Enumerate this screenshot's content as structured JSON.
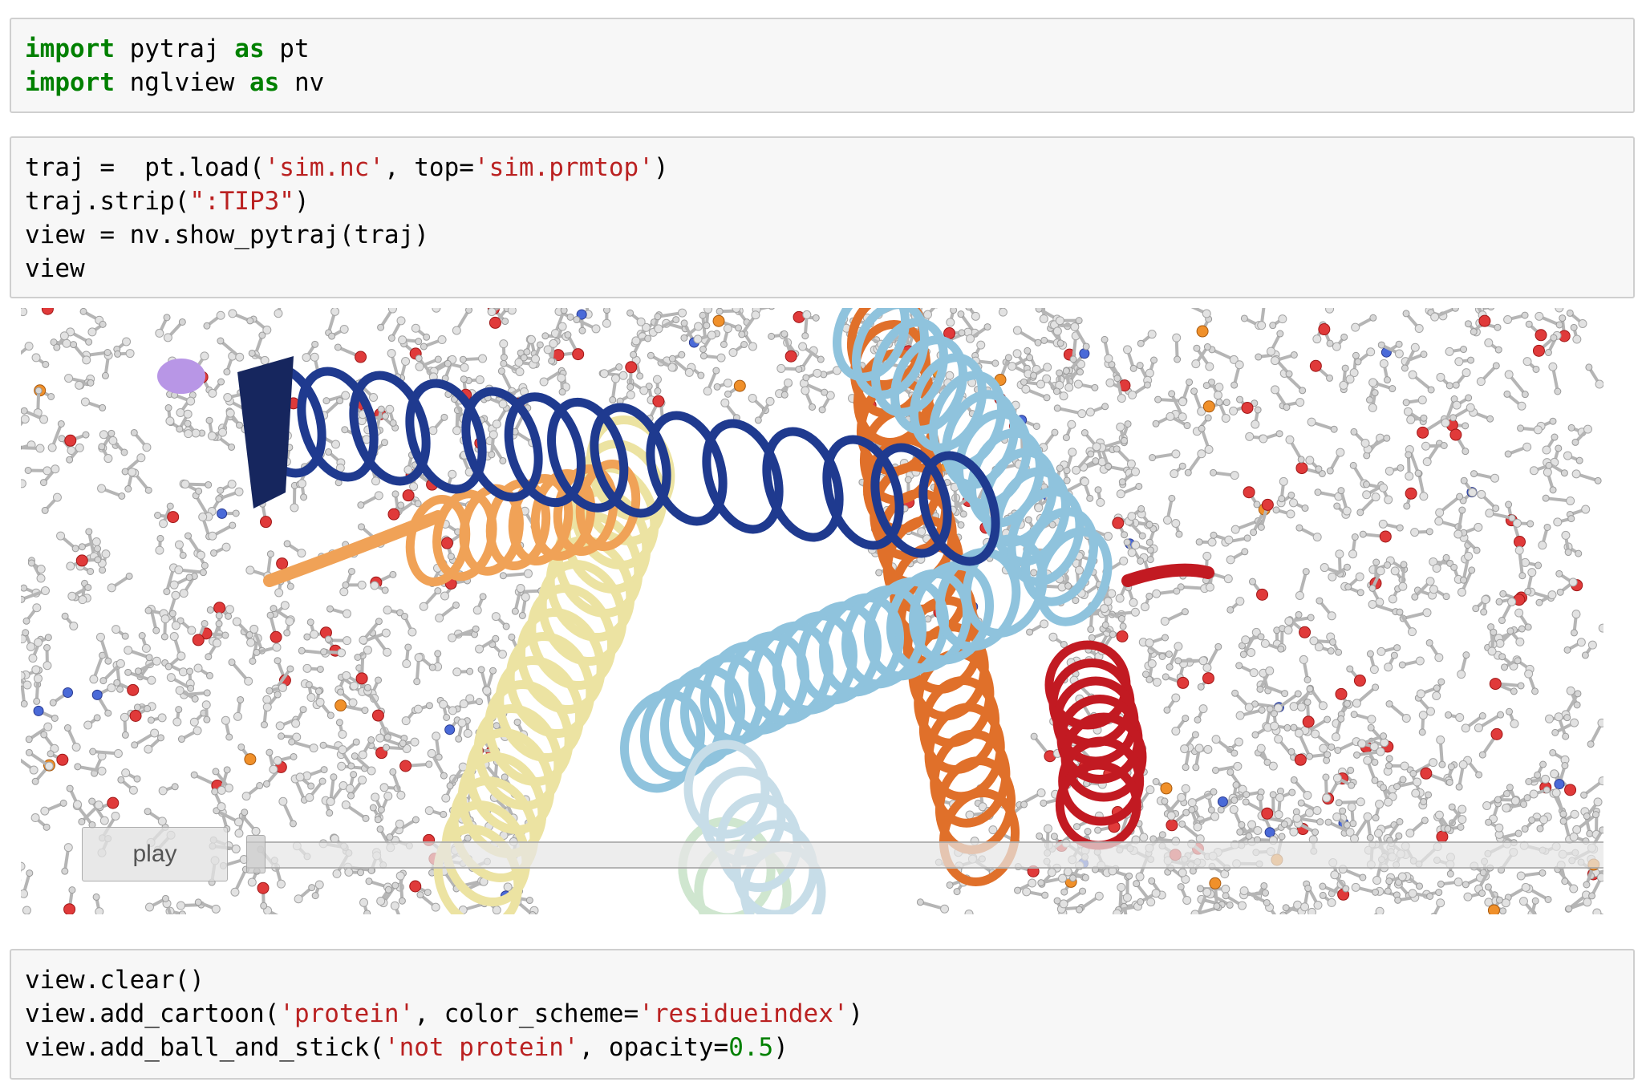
{
  "cells": [
    {
      "lines": [
        [
          {
            "t": "import",
            "c": "kw"
          },
          {
            "t": " pytraj ",
            "c": ""
          },
          {
            "t": "as",
            "c": "kw"
          },
          {
            "t": " pt",
            "c": ""
          }
        ],
        [
          {
            "t": "import",
            "c": "kw"
          },
          {
            "t": " nglview ",
            "c": ""
          },
          {
            "t": "as",
            "c": "kw"
          },
          {
            "t": " nv",
            "c": ""
          }
        ]
      ]
    },
    {
      "lines": [
        [
          {
            "t": "traj =  pt.load(",
            "c": ""
          },
          {
            "t": "'sim.nc'",
            "c": "str"
          },
          {
            "t": ", top=",
            "c": ""
          },
          {
            "t": "'sim.prmtop'",
            "c": "str"
          },
          {
            "t": ")",
            "c": ""
          }
        ],
        [
          {
            "t": "traj.strip(",
            "c": ""
          },
          {
            "t": "\":TIP3\"",
            "c": "str"
          },
          {
            "t": ")",
            "c": ""
          }
        ],
        [
          {
            "t": "view = nv.show_pytraj(traj)",
            "c": ""
          }
        ],
        [
          {
            "t": "view",
            "c": ""
          }
        ]
      ]
    },
    {
      "lines": [
        [
          {
            "t": "view.clear()",
            "c": ""
          }
        ],
        [
          {
            "t": "view.add_cartoon(",
            "c": ""
          },
          {
            "t": "'protein'",
            "c": "str"
          },
          {
            "t": ", color_scheme=",
            "c": ""
          },
          {
            "t": "'residueindex'",
            "c": "str"
          },
          {
            "t": ")",
            "c": ""
          }
        ],
        [
          {
            "t": "view.add_ball_and_stick(",
            "c": ""
          },
          {
            "t": "'not protein'",
            "c": "str"
          },
          {
            "t": ", opacity=",
            "c": ""
          },
          {
            "t": "0.5",
            "c": "num"
          },
          {
            "t": ")",
            "c": ""
          }
        ]
      ]
    }
  ],
  "viewer": {
    "play_label": "play",
    "frame_position": 0,
    "colors": {
      "helix_navy": "#1f3a8f",
      "helix_orange": "#e0702a",
      "helix_light_orange": "#f0a257",
      "helix_light_blue": "#8fc3dd",
      "helix_yellow": "#ece3a2",
      "helix_red": "#c21a22",
      "helix_mint": "#cfe6cf",
      "stick_gray": "#b5b5b5",
      "oxygen_red": "#e03a3a",
      "phosphorus_orange": "#f0902a",
      "nitrogen_blue": "#4a6ad8",
      "ion_purple": "#b896e6"
    }
  }
}
